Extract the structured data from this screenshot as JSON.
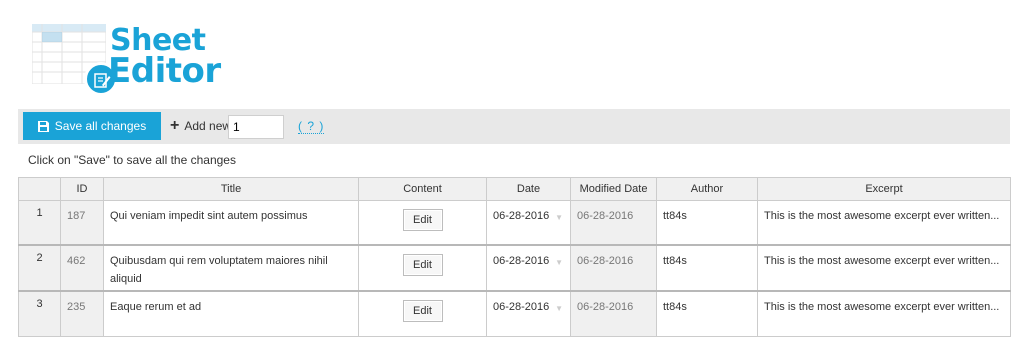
{
  "logo": {
    "line1": "Sheet",
    "line2": "Editor"
  },
  "toolbar": {
    "save_label": "Save all changes",
    "add_label": "Add new",
    "add_value": "1",
    "help_label": "( ? )"
  },
  "hint": "Click on \"Save\" to save all the changes",
  "table": {
    "columns": [
      "",
      "ID",
      "Title",
      "Content",
      "Date",
      "Modified Date",
      "Author",
      "Excerpt"
    ],
    "rows": [
      {
        "num": "1",
        "id": "187",
        "title": "Qui veniam impedit sint autem possimus",
        "content": "Edit",
        "date": "06-28-2016",
        "modified": "06-28-2016",
        "author": "tt84s",
        "excerpt": "This is the most awesome excerpt ever written..."
      },
      {
        "num": "2",
        "id": "462",
        "title": "Quibusdam qui rem voluptatem maiores nihil aliquid",
        "content": "Edit",
        "date": "06-28-2016",
        "modified": "06-28-2016",
        "author": "tt84s",
        "excerpt": "This is the most awesome excerpt ever written..."
      },
      {
        "num": "3",
        "id": "235",
        "title": "Eaque rerum et ad",
        "content": "Edit",
        "date": "06-28-2016",
        "modified": "06-28-2016",
        "author": "tt84s",
        "excerpt": "This is the most awesome excerpt ever written..."
      }
    ]
  },
  "colors": {
    "accent": "#1aa3d7",
    "toolbar_bg": "#e8e8e8",
    "readonly_bg": "#f0f0f0"
  }
}
